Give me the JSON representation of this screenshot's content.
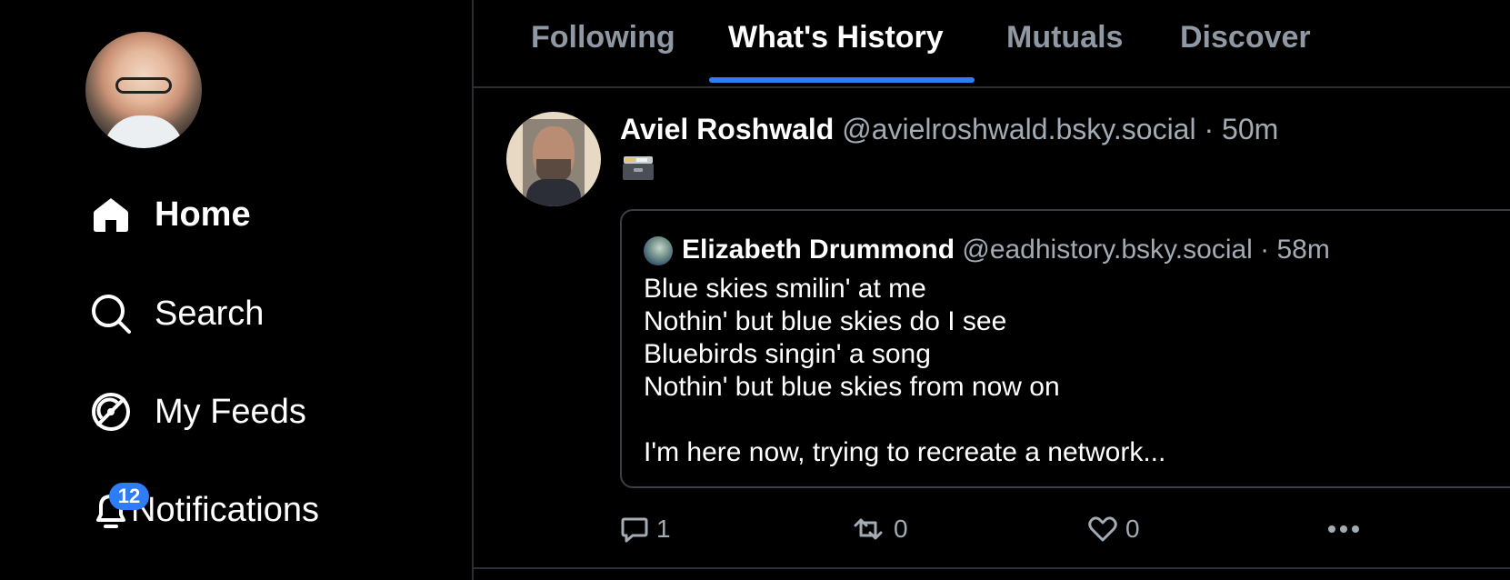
{
  "sidebar": {
    "nav": [
      {
        "label": "Home",
        "icon": "home-icon",
        "active": true
      },
      {
        "label": "Search",
        "icon": "search-icon"
      },
      {
        "label": "My Feeds",
        "icon": "feeds-icon"
      },
      {
        "label": "Notifications",
        "icon": "bell-icon",
        "badge": "12"
      }
    ]
  },
  "tabs": [
    {
      "label": "Following"
    },
    {
      "label": "What's History",
      "active": true
    },
    {
      "label": "Mutuals"
    },
    {
      "label": "Discover"
    }
  ],
  "post": {
    "author": "Aviel Roshwald",
    "handle_meta": "@avielroshwald.bsky.social · 50m",
    "emoji_icon": "card-file-box-icon",
    "quote": {
      "author": "Elizabeth Drummond",
      "handle_meta": "@eadhistory.bsky.social · 58m",
      "lines": [
        "Blue skies smilin' at me",
        "Nothin' but blue skies do I see",
        "Bluebirds singin' a song",
        "Nothin' but blue skies from now on",
        "",
        "I'm here now, trying to recreate a network..."
      ]
    },
    "actions": {
      "replies": "1",
      "reposts": "0",
      "likes": "0"
    }
  },
  "colors": {
    "accent": "#2f7df6",
    "muted": "#a3abb5",
    "border": "#2c2f34"
  }
}
